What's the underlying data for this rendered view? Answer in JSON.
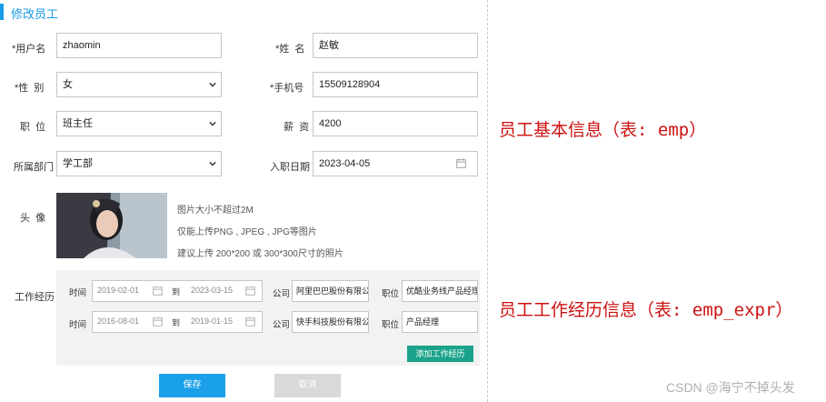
{
  "header": {
    "title": "修改员工"
  },
  "fields": {
    "username": {
      "label": "用户名",
      "value": "zhaomin"
    },
    "name": {
      "label": "姓  名",
      "value": "赵敏"
    },
    "gender": {
      "label": "性  别",
      "value": "女"
    },
    "phone": {
      "label": "手机号",
      "value": "15509128904"
    },
    "position": {
      "label": "职  位",
      "value": "班主任"
    },
    "salary": {
      "label": "薪  资",
      "value": "4200"
    },
    "department": {
      "label": "所属部门",
      "value": "学工部"
    },
    "hire_date": {
      "label": "入职日期",
      "value": "2023-04-05"
    }
  },
  "required_mark": "*",
  "avatar": {
    "label": "头  像",
    "hints": [
      "图片大小不超过2M",
      "仅能上传PNG , JPEG , JPG等图片",
      "建议上传 200*200 或 300*300尺寸的照片"
    ]
  },
  "experience": {
    "label": "工作经历",
    "time_label": "时间",
    "to_label": "到",
    "company_label": "公司",
    "position_label": "职位",
    "rows": [
      {
        "start": "2019-02-01",
        "end": "2023-03-15",
        "company": "阿里巴巴股份有限公司",
        "position": "优酷业务线产品经理"
      },
      {
        "start": "2016-08-01",
        "end": "2019-01-15",
        "company": "快手科技股份有限公司",
        "position": "产品经理"
      }
    ],
    "add_button": "添加工作经历"
  },
  "buttons": {
    "save": "保存",
    "cancel": "取消"
  },
  "annotations": {
    "basic": "员工基本信息（表: emp）",
    "expr": "员工工作经历信息（表: emp_expr）"
  },
  "watermark": "CSDN @海宁不掉头发",
  "colors": {
    "accent": "#1a9be6",
    "add_button": "#1aa38a",
    "annotation": "#cc1111"
  }
}
